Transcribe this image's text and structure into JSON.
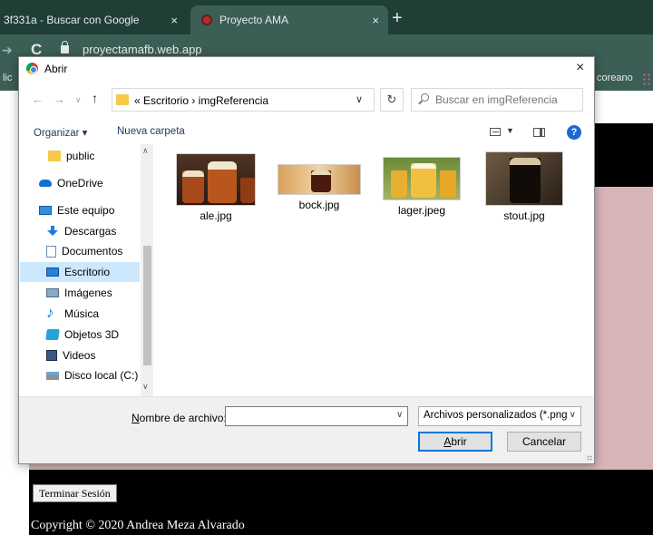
{
  "browser": {
    "tabs": [
      {
        "title": "3f331a - Buscar con Google",
        "close": "×"
      },
      {
        "title": "Proyecto AMA",
        "close": "×"
      }
    ],
    "new_tab": "+",
    "url": "proyectamafb.web.app",
    "bookmarks_left": "lic",
    "bookmarks_right": "coreano"
  },
  "page": {
    "logout_button": "Terminar Sesión",
    "copyright": "Copyright © 2020 Andrea Meza Alvarado",
    "colors": {
      "band": "#000000",
      "panel": "#d6b4b8"
    }
  },
  "dialog": {
    "title": "Abrir",
    "close": "×",
    "breadcrumb": "« Escritorio  ›  imgReferencia",
    "search_placeholder": "Buscar en imgReferencia",
    "organize": "Organizar ▾",
    "new_folder": "Nueva carpeta",
    "help": "?",
    "nav_items": [
      {
        "label": "public",
        "icon": "folder-icon"
      },
      {
        "label": "OneDrive",
        "icon": "cloud-icon"
      },
      {
        "label": "Este equipo",
        "icon": "computer-icon"
      },
      {
        "label": "Descargas",
        "icon": "download-icon"
      },
      {
        "label": "Documentos",
        "icon": "document-icon"
      },
      {
        "label": "Escritorio",
        "icon": "desktop-icon",
        "selected": true
      },
      {
        "label": "Imágenes",
        "icon": "pictures-icon"
      },
      {
        "label": "Música",
        "icon": "music-icon"
      },
      {
        "label": "Objetos 3D",
        "icon": "objects-3d-icon"
      },
      {
        "label": "Videos",
        "icon": "video-icon"
      },
      {
        "label": "Disco local (C:)",
        "icon": "disk-icon"
      }
    ],
    "files": [
      {
        "name": "ale.jpg"
      },
      {
        "name": "bock.jpg"
      },
      {
        "name": "lager.jpeg"
      },
      {
        "name": "stout.jpg"
      }
    ],
    "filename_label_first": "N",
    "filename_label_rest": "ombre de archivo:",
    "filename_value": "",
    "file_type": "Archivos personalizados (*.png;",
    "open_first": "A",
    "open_rest": "brir",
    "cancel": "Cancelar"
  }
}
